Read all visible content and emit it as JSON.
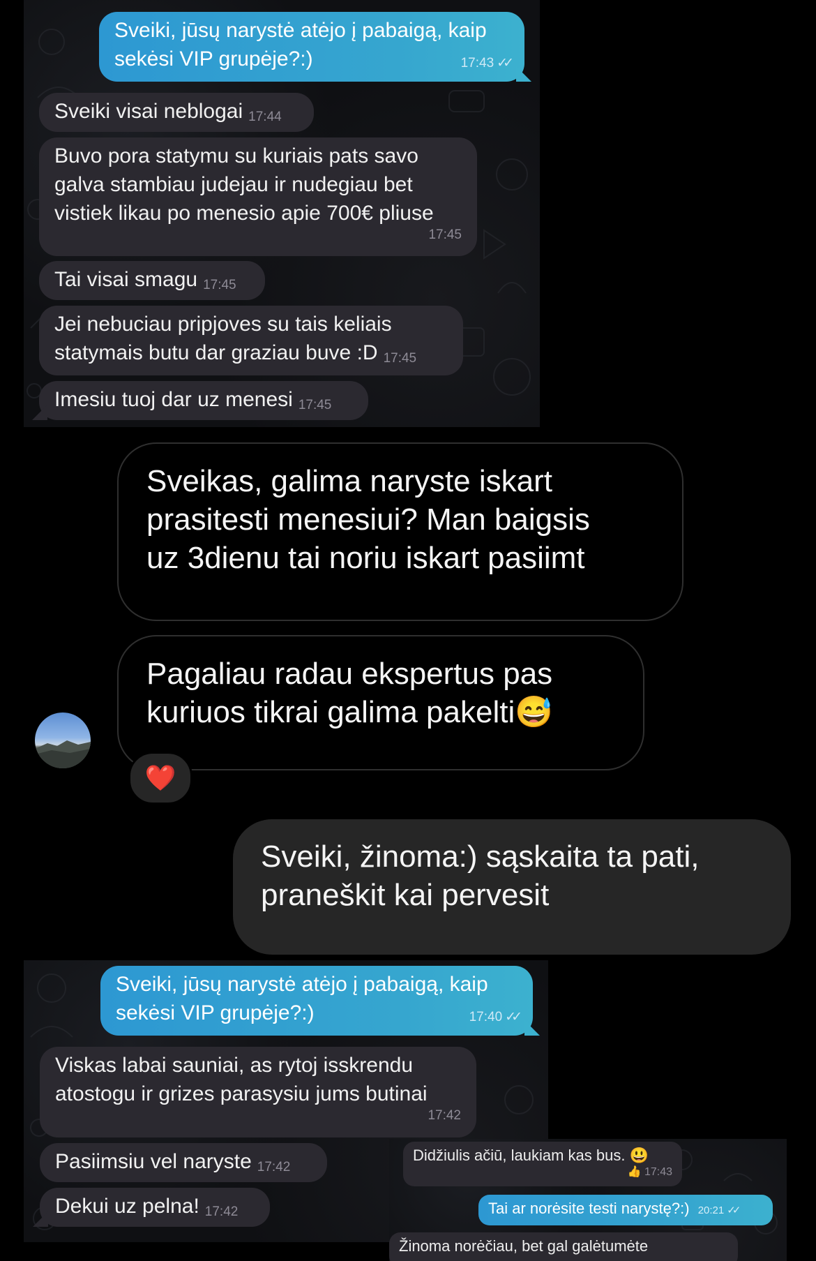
{
  "top_chat": {
    "m1": {
      "text1": "Sveiki, jūsų narystė atėjo į pabaigą, kaip",
      "text2": "sekėsi VIP grupėje?:)",
      "time": "17:43"
    },
    "m2": {
      "text": "Sveiki visai neblogai",
      "time": "17:44"
    },
    "m3": {
      "text1": "Buvo pora statymu su kuriais pats savo",
      "text2": "galva stambiau judejau ir nudegiau bet",
      "text3": "vistiek likau po menesio apie 700€ pliuse",
      "time": "17:45"
    },
    "m4": {
      "text": "Tai visai smagu",
      "time": "17:45"
    },
    "m5": {
      "text1": "Jei nebuciau pripjoves su tais keliais",
      "text2": "statymais butu dar graziau buve :D",
      "time": "17:45"
    },
    "m6": {
      "text": "Imesiu tuoj dar uz menesi",
      "time": "17:45"
    }
  },
  "ig_chat": {
    "m1": {
      "line1": "Sveikas, galima naryste iskart",
      "line2": "prasitesti menesiui? Man baigsis",
      "line3": "uz 3dienu tai noriu iskart pasiimt"
    },
    "m2": {
      "line1": "Pagaliau radau ekspertus pas",
      "line2": "kuriuos tikrai galima pakelti",
      "emoji": "😅"
    },
    "reaction": "❤️",
    "reply": {
      "line1": "Sveiki, žinoma:) sąskaita ta pati,",
      "line2": "praneškit kai pervesit"
    }
  },
  "bottom_chat": {
    "m1": {
      "text1": "Sveiki, jūsų narystė atėjo į pabaigą, kaip",
      "text2": "sekėsi VIP grupėje?:)",
      "time": "17:40"
    },
    "m2": {
      "text1": "Viskas labai sauniai, as rytoj isskrendu",
      "text2": "atostogu ir grizes parasysiu jums butinai",
      "time": "17:42"
    },
    "m3": {
      "text": "Pasiimsiu vel naryste",
      "time": "17:42"
    },
    "m4": {
      "text": "Dekui uz pelna!",
      "time": "17:42"
    }
  },
  "right_chat": {
    "m1": {
      "text": "Didžiulis ačiū, laukiam kas bus.",
      "emoji": "😃",
      "reaction": "👍",
      "time": "17:43"
    },
    "m2": {
      "text": "Tai ar norėsite testi narystę?:)",
      "time": "20:21"
    },
    "m3": {
      "text": "Žinoma norėčiau, bet gal galėtumėte"
    }
  },
  "icons": {
    "read_receipt": "double-check-icon"
  },
  "colors": {
    "outgoing": "#36a6cf",
    "incoming": "#2b2930",
    "ig_outgoing": "#262626"
  }
}
